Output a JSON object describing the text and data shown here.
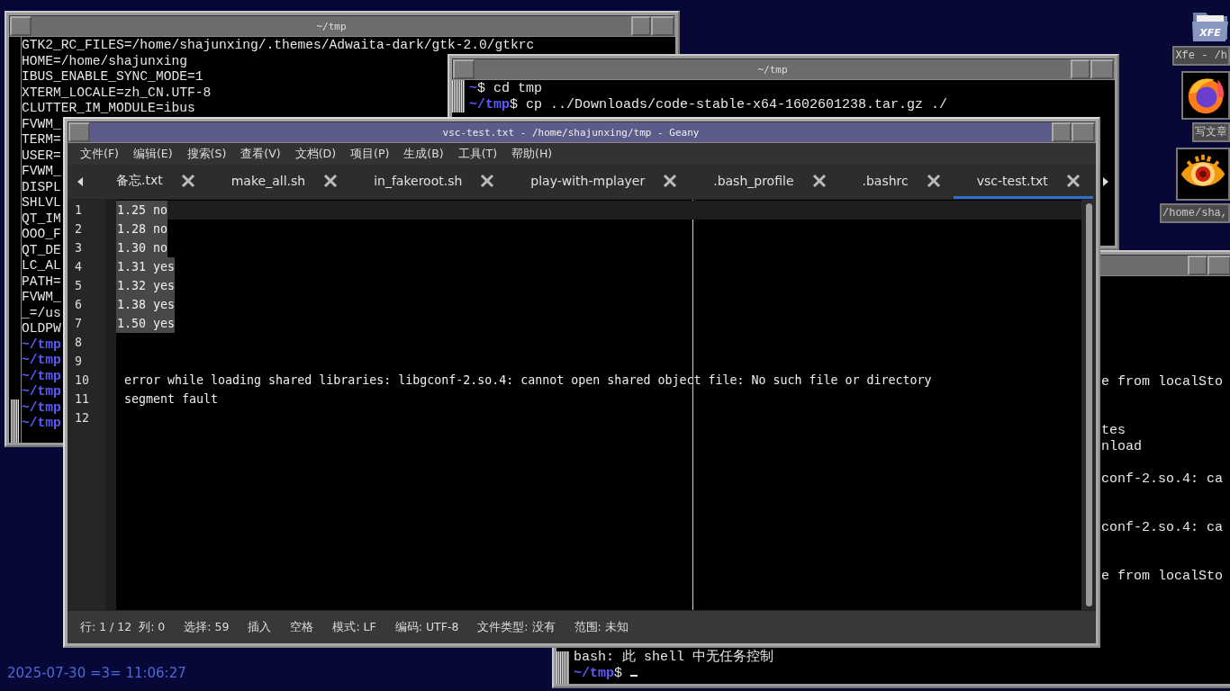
{
  "terminals": [
    {
      "title": "~/tmp",
      "lines": [
        {
          "text": "GTK2_RC_FILES=/home/shajunxing/.themes/Adwaita-dark/gtk-2.0/gtkrc"
        },
        {
          "text": "HOME=/home/shajunxing"
        },
        {
          "text": "IBUS_ENABLE_SYNC_MODE=1"
        },
        {
          "text": "XTERM_LOCALE=zh_CN.UTF-8"
        },
        {
          "text": "CLUTTER_IM_MODULE=ibus"
        },
        {
          "text": "FVWM_"
        },
        {
          "text": "TERM="
        },
        {
          "text": "USER="
        },
        {
          "text": "FVWM_"
        },
        {
          "text": "DISPL"
        },
        {
          "text": "SHLVL"
        },
        {
          "text": "QT_IM"
        },
        {
          "text": "OOO_F"
        },
        {
          "text": "QT_DE"
        },
        {
          "text": "LC_AL"
        },
        {
          "text": "PATH="
        },
        {
          "text": "FVWM_"
        },
        {
          "text": "_=/us"
        },
        {
          "text": "OLDPW"
        },
        {
          "prompt": "~/tmp"
        },
        {
          "prompt": "~/tmp"
        },
        {
          "prompt": "~/tmp"
        },
        {
          "prompt": "~/tmp"
        },
        {
          "prompt": "~/tmp"
        },
        {
          "prompt": "~/tmp"
        }
      ]
    },
    {
      "title": "~/tmp",
      "lines": [
        {
          "prompt": "~",
          "text": "$ cd tmp"
        },
        {
          "prompt": "~/tmp",
          "text": "$ cp ../Downloads/code-stable-x64-1602601238.tar.gz ./"
        }
      ]
    },
    {
      "lines": [
        {
          "text": "e from localSto"
        },
        {
          "text": "tes"
        },
        {
          "text": "nload"
        },
        {
          "text": "conf-2.so.4: ca"
        },
        {
          "text": "conf-2.so.4: ca"
        },
        {
          "text": "e from localSto"
        },
        {
          "text": "bash: 此 shell 中无任务控制"
        },
        {
          "prompt": "~/tmp",
          "text": "$",
          "cursor": true
        }
      ]
    }
  ],
  "editor_window": {
    "title": "vsc-test.txt - /home/shajunxing/tmp - Geany",
    "menu": [
      "文件(F)",
      "编辑(E)",
      "搜索(S)",
      "查看(V)",
      "文档(D)",
      "项目(P)",
      "生成(B)",
      "工具(T)",
      "帮助(H)"
    ],
    "tabs": [
      {
        "label": "备忘.txt",
        "selected": false
      },
      {
        "label": "make_all.sh",
        "selected": false
      },
      {
        "label": "in_fakeroot.sh",
        "selected": false
      },
      {
        "label": "play-with-mplayer",
        "selected": false
      },
      {
        "label": ".bash_profile",
        "selected": false
      },
      {
        "label": ".bashrc",
        "selected": false
      },
      {
        "label": "vsc-test.txt",
        "selected": true
      }
    ],
    "lines": [
      {
        "number": "1",
        "text": "1.25 no",
        "selected": true,
        "current": true
      },
      {
        "number": "2",
        "text": "1.28 no",
        "selected": true,
        "current": false
      },
      {
        "number": "3",
        "text": "1.30 no",
        "selected": true,
        "current": false
      },
      {
        "number": "4",
        "text": "1.31 yes",
        "selected": true,
        "current": false
      },
      {
        "number": "5",
        "text": "1.32 yes",
        "selected": true,
        "current": false
      },
      {
        "number": "6",
        "text": "1.38 yes",
        "selected": true,
        "current": false
      },
      {
        "number": "7",
        "text": "1.50 yes",
        "selected": true,
        "current": false
      },
      {
        "number": "8",
        "selected": false,
        "current": false
      },
      {
        "number": "9",
        "selected": false,
        "current": false
      },
      {
        "number": "10",
        "text": " error while loading shared libraries: libgconf-2.so.4: cannot open shared object file: No such file or directory",
        "selected": false,
        "current": false
      },
      {
        "number": "11",
        "text": " segment fault",
        "selected": false,
        "current": false
      },
      {
        "number": "12",
        "selected": false,
        "current": false
      }
    ],
    "status": [
      "行: 1 / 12  列: 0",
      "选择: 59",
      "插入",
      "空格",
      "模式: LF",
      "编码: UTF-8",
      "文件类型: 没有",
      "范围: 未知"
    ]
  },
  "desktop": {
    "icons": [
      {
        "kind": "xfe",
        "icon_text": "XFE",
        "label": "Xfe - /h"
      },
      {
        "kind": "firefox",
        "label": "写文章"
      },
      {
        "kind": "xnview",
        "label": "/home/sha,"
      }
    ],
    "clock": "2025-07-30 =3= 11:06:27"
  }
}
